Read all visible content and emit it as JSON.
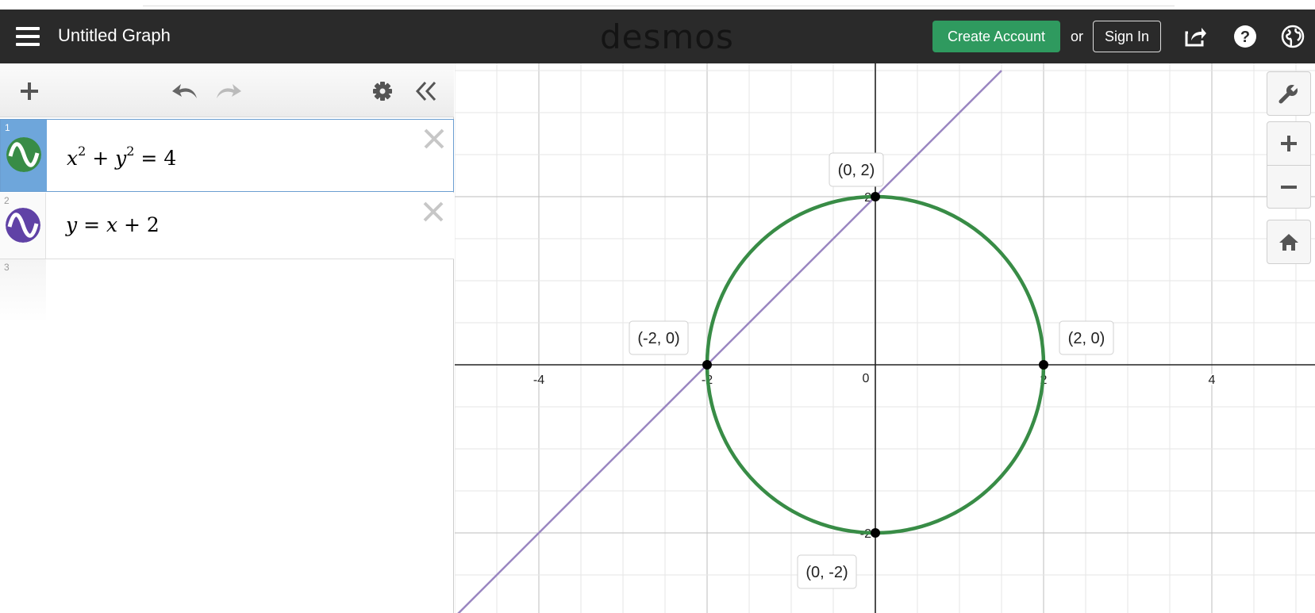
{
  "header": {
    "title": "Untitled Graph",
    "logo": "desmos",
    "create_account": "Create Account",
    "or": "or",
    "sign_in": "Sign In",
    "icons": [
      "menu-icon",
      "share-icon",
      "help-icon",
      "language-globe-icon"
    ]
  },
  "toolbar": {
    "icons": [
      "add-icon",
      "undo-icon",
      "redo-icon",
      "settings-gear-icon",
      "collapse-panel-icon"
    ]
  },
  "expressions": [
    {
      "index": "1",
      "latex": "x^2+y^2=4",
      "color": "#388c46",
      "active": true
    },
    {
      "index": "2",
      "latex": "y=x+2",
      "color": "#6042a6",
      "active": false
    },
    {
      "index": "3",
      "latex": "",
      "active": false
    }
  ],
  "graph": {
    "x_range": [
      -5,
      5
    ],
    "y_range": [
      -3,
      3.5
    ],
    "x_tick_labels": [
      "-4",
      "-2",
      "0",
      "2",
      "4"
    ],
    "y_tick_labels": [
      "2",
      "-2"
    ],
    "origin_label": "0",
    "points": [
      {
        "x": 0,
        "y": 2,
        "label": "(0, 2)"
      },
      {
        "x": -2,
        "y": 0,
        "label": "(-2, 0)"
      },
      {
        "x": 2,
        "y": 0,
        "label": "(2, 0)"
      },
      {
        "x": 0,
        "y": -2,
        "label": "(0, -2)"
      }
    ],
    "controls": [
      "wrench-icon",
      "zoom-in-icon",
      "zoom-out-icon",
      "home-icon"
    ]
  }
}
